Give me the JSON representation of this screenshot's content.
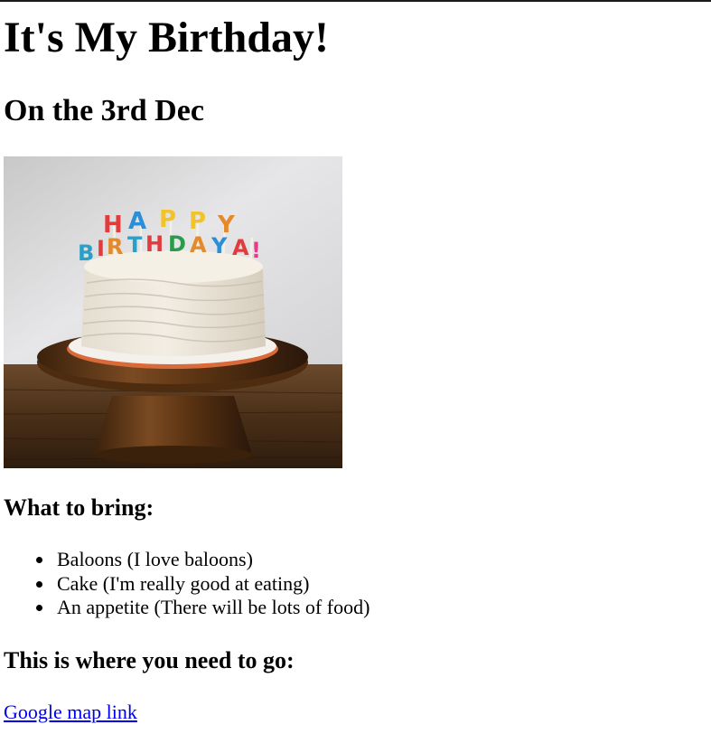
{
  "header": {
    "title": "It's My Birthday!",
    "date": "On the 3rd Dec"
  },
  "image": {
    "description_icon": "birthday-cake-image",
    "topper_line1": "HAPPY",
    "topper_line2": "BIRTHDAY!"
  },
  "bring": {
    "heading": "What to bring:",
    "items": [
      "Baloons (I love baloons)",
      "Cake (I'm really good at eating)",
      "An appetite (There will be lots of food)"
    ]
  },
  "location": {
    "heading": "This is where you need to go:",
    "link_text": "Google map link"
  },
  "colors": {
    "link": "#0000ee",
    "text": "#000000",
    "background": "#ffffff"
  }
}
